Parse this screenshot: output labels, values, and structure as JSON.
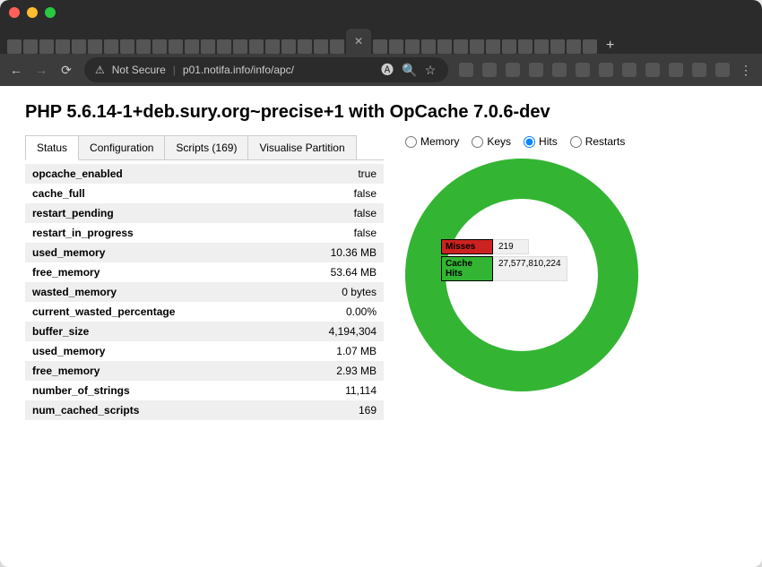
{
  "browser": {
    "security_label": "Not Secure",
    "url": "p01.notifa.info/info/apc/",
    "newtab_label": "+"
  },
  "page": {
    "title": "PHP 5.6.14-1+deb.sury.org~precise+1 with OpCache 7.0.6-dev"
  },
  "tabs": [
    {
      "label": "Status",
      "active": true
    },
    {
      "label": "Configuration",
      "active": false
    },
    {
      "label": "Scripts (169)",
      "active": false
    },
    {
      "label": "Visualise Partition",
      "active": false
    }
  ],
  "status_rows": [
    {
      "k": "opcache_enabled",
      "v": "true"
    },
    {
      "k": "cache_full",
      "v": "false"
    },
    {
      "k": "restart_pending",
      "v": "false"
    },
    {
      "k": "restart_in_progress",
      "v": "false"
    },
    {
      "k": "used_memory",
      "v": "10.36 MB"
    },
    {
      "k": "free_memory",
      "v": "53.64 MB"
    },
    {
      "k": "wasted_memory",
      "v": "0 bytes"
    },
    {
      "k": "current_wasted_percentage",
      "v": "0.00%"
    },
    {
      "k": "buffer_size",
      "v": "4,194,304"
    },
    {
      "k": "used_memory",
      "v": "1.07 MB"
    },
    {
      "k": "free_memory",
      "v": "2.93 MB"
    },
    {
      "k": "number_of_strings",
      "v": "11,114"
    },
    {
      "k": "num_cached_scripts",
      "v": "169"
    }
  ],
  "chart_radios": [
    {
      "label": "Memory",
      "checked": false
    },
    {
      "label": "Keys",
      "checked": false
    },
    {
      "label": "Hits",
      "checked": true
    },
    {
      "label": "Restarts",
      "checked": false
    }
  ],
  "chart_legend": {
    "misses_label": "Misses",
    "misses_value": "219",
    "hits_label": "Cache Hits",
    "hits_value": "27,577,810,224"
  },
  "chart_data": {
    "type": "pie",
    "title": "Hits",
    "series": [
      {
        "name": "Misses",
        "value": 219,
        "color": "#cc2222"
      },
      {
        "name": "Cache Hits",
        "value": 27577810224,
        "color": "#33b533"
      }
    ]
  }
}
